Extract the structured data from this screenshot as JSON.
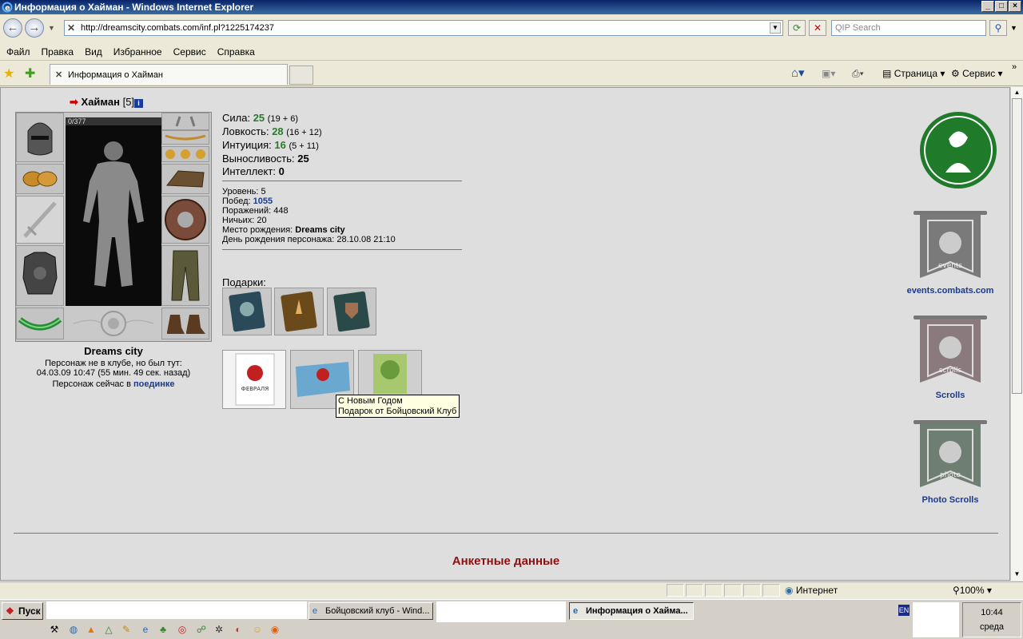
{
  "window": {
    "title": "Информация о Хайман - Windows Internet Explorer"
  },
  "address": {
    "url": "http://dreamscity.combats.com/inf.pl?1225174237",
    "search_placeholder": "QIP Search"
  },
  "menu": {
    "items": [
      "Файл",
      "Правка",
      "Вид",
      "Избранное",
      "Сервис",
      "Справка"
    ]
  },
  "tabs": {
    "active_title": "Информация о Хайман",
    "page_label": "Страница",
    "tools_label": "Сервис"
  },
  "character": {
    "name": "Хайман",
    "level": "[5]",
    "hp": "0/377",
    "city": "Dreams city",
    "status_line1": "Персонаж не в клубе, но был тут:",
    "status_line2": "04.03.09 10:47 (55 мин. 49 сек. назад)",
    "status_line3_prefix": "Персонаж сейчас в",
    "status_line3_link": "поединке"
  },
  "stats": [
    {
      "label": "Сила:",
      "value": "25",
      "detail": "(19 + 6)"
    },
    {
      "label": "Ловкость:",
      "value": "28",
      "detail": "(16 + 12)"
    },
    {
      "label": "Интуиция:",
      "value": "16",
      "detail": "(5 + 11)"
    },
    {
      "label": "Выносливость:",
      "value": "25",
      "detail": ""
    },
    {
      "label": "Интеллект:",
      "value": "0",
      "detail": ""
    }
  ],
  "details": {
    "level_label": "Уровень:",
    "level_value": "5",
    "wins_label": "Побед:",
    "wins_value": "1055",
    "losses_label": "Поражений:",
    "losses_value": "448",
    "draws_label": "Ничьих:",
    "draws_value": "20",
    "birthplace_label": "Место рождения:",
    "birthplace_value": "Dreams city",
    "birthday_label": "День рождения персонажа:",
    "birthday_value": "28.10.08 21:10"
  },
  "gifts": {
    "label": "Подарки:",
    "card_feb_text": "ФЕВРАЛЯ"
  },
  "tooltip": {
    "line1": "С Новым Годом",
    "line2": "Подарок от Бойцовский Клуб"
  },
  "right_links": {
    "events_label": "events.combats.com",
    "events_banner_text": "events",
    "scrolls_label": "Scrolls",
    "scrolls_banner_text": "scrolls",
    "photo_label": "Photo Scrolls",
    "photo_banner_text": "photo"
  },
  "profile": {
    "title": "Анкетные данные"
  },
  "statusbar": {
    "zone": "Интернет",
    "zoom": "100%"
  },
  "taskbar": {
    "start": "Пуск",
    "task1": "Бойцовский клуб - Wind...",
    "task2": "Информация о Хайма...",
    "lang": "EN",
    "time": "10:44",
    "day": "среда"
  },
  "colors": {
    "stat_value": "#2a7a2a",
    "link_blue": "#1a3a8a",
    "profile_title": "#8b1010",
    "emblem_green": "#1f7a2a"
  }
}
